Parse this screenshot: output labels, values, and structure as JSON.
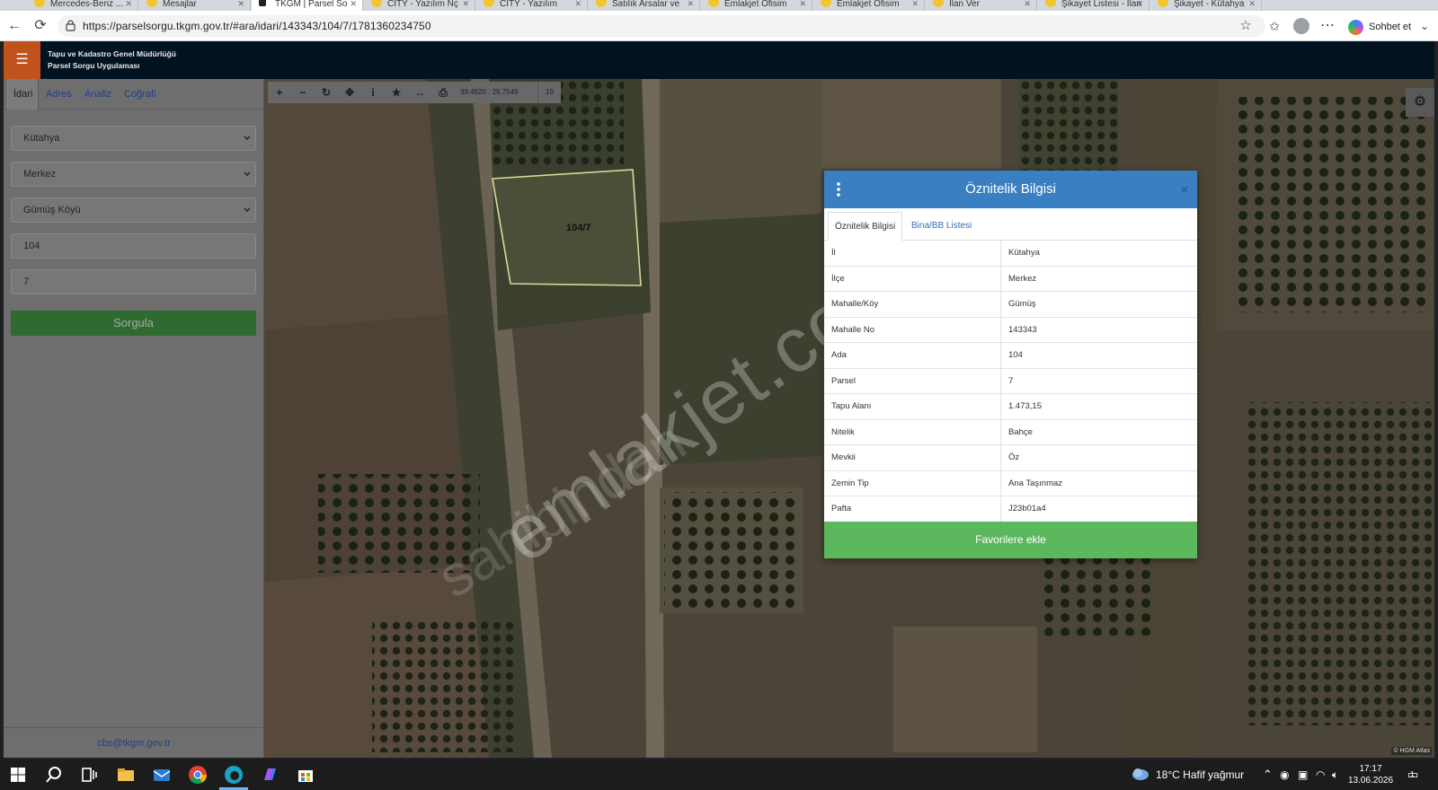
{
  "browser": {
    "url": "https://parselsorgu.tkgm.gov.tr/#ara/idari/143343/104/7/1781360234750",
    "chat_label": "Sohbet et",
    "tabs": [
      "Mercedes-Benz ...",
      "Mesajlar",
      "TKGM | Parsel So",
      "CITY - Yazılım Nç",
      "CITY - Yazılım",
      "Satılık Arsalar ve",
      "Emlakjet Ofisim",
      "Emlakjet Ofisim",
      "İlan Ver",
      "Şikayet Listesi - İlan",
      "Şikayet - Kütahya"
    ]
  },
  "app": {
    "title_line1": "Tapu ve Kadastro Genel Müdürlüğü",
    "title_line2": "Parsel Sorgu Uygulaması",
    "menu_icon": "hamburger-icon"
  },
  "left_panel": {
    "tabs": [
      "İdari",
      "Adres",
      "Analiz",
      "Coğrafi"
    ],
    "province": "Kütahya",
    "district": "Merkez",
    "neighborhood": "Gümüş Köyü",
    "block": "104",
    "parcel": "7",
    "submit": "Sorgula",
    "footer": "cbs@tkgm.gov.tr"
  },
  "map": {
    "coordinates": "39.4820 : 29.7549",
    "zoom": "19",
    "parcel_label": "104/7",
    "attribution": "© HGM Atlas",
    "watermark_main": "emlakjet.com",
    "watermark_secondary": "sahibinden"
  },
  "dialog": {
    "title": "Öznitelik Bilgisi",
    "close": "×",
    "tabs": [
      "Öznitelik Bilgisi",
      "Bina/BB Listesi"
    ],
    "rows": [
      {
        "key": "İl",
        "value": "Kütahya"
      },
      {
        "key": "İlçe",
        "value": "Merkez"
      },
      {
        "key": "Mahalle/Köy",
        "value": "Gümüş"
      },
      {
        "key": "Mahalle No",
        "value": "143343"
      },
      {
        "key": "Ada",
        "value": "104"
      },
      {
        "key": "Parsel",
        "value": "7"
      },
      {
        "key": "Tapu Alanı",
        "value": "1.473,15"
      },
      {
        "key": "Nitelik",
        "value": "Bahçe"
      },
      {
        "key": "Mevkii",
        "value": "Öz"
      },
      {
        "key": "Zemin Tip",
        "value": "Ana Taşınmaz"
      },
      {
        "key": "Pafta",
        "value": "J23b01a4"
      }
    ],
    "button": "Favorilere ekle"
  },
  "taskbar": {
    "weather": "18°C  Hafif yağmur",
    "time": "17:17",
    "date": "13.06.2026",
    "notification_count": "1"
  }
}
